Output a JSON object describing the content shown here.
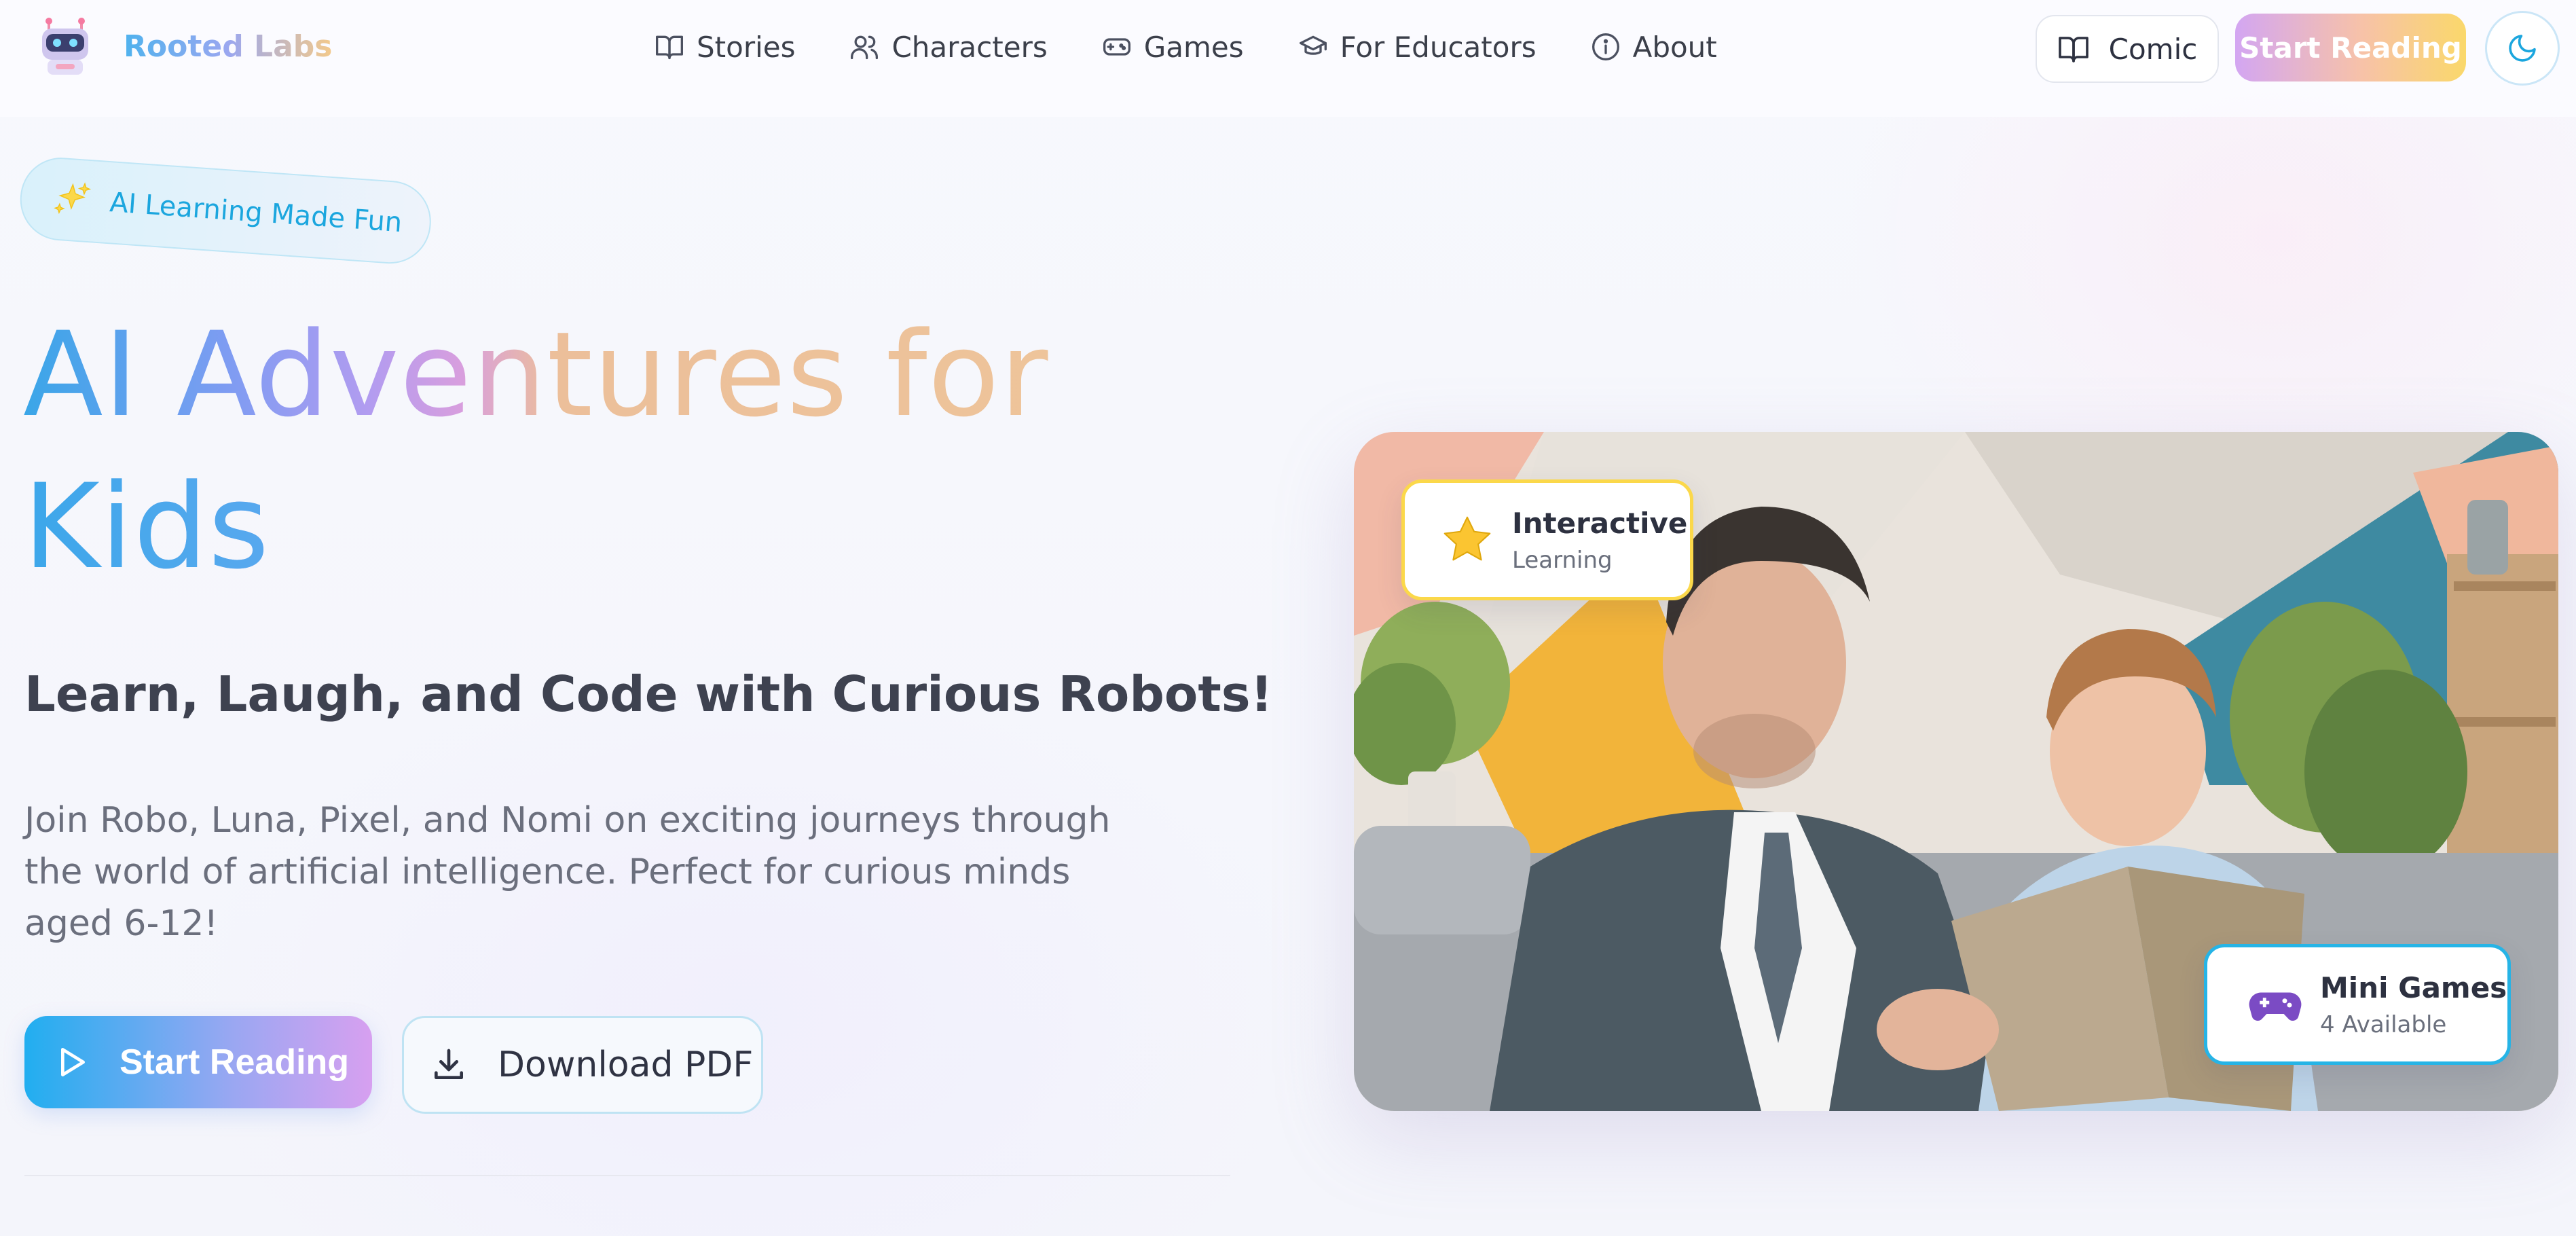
{
  "brand": {
    "name": "Rooted Labs"
  },
  "nav": [
    {
      "label": "Stories",
      "icon": "book-icon"
    },
    {
      "label": "Characters",
      "icon": "users-icon"
    },
    {
      "label": "Games",
      "icon": "gamepad-icon"
    },
    {
      "label": "For Educators",
      "icon": "graduation-cap-icon"
    },
    {
      "label": "About",
      "icon": "info-icon"
    }
  ],
  "header_actions": {
    "comic_label": "Comic",
    "start_reading_label": "Start Reading",
    "theme_toggle_icon": "moon-icon"
  },
  "badge": {
    "label": "AI Learning Made Fun",
    "icon": "sparkles-icon"
  },
  "hero": {
    "title_line1": "AI Adventures for",
    "title_line2": "Kids",
    "subtitle": "Learn, Laugh, and Code with Curious Robots!",
    "description": "Join Robo, Luna, Pixel, and Nomi on exciting journeys through the world of artificial intelligence. Perfect for curious minds aged 6-12!",
    "primary_button": "Start Reading",
    "secondary_button": "Download PDF"
  },
  "feature_cards": {
    "interactive": {
      "title": "Interactive",
      "subtitle": "Learning",
      "icon": "star-icon"
    },
    "games": {
      "title": "Mini Games",
      "subtitle": "4 Available",
      "icon": "gamepad-icon"
    }
  },
  "colors": {
    "accent_blue": "#21aef0",
    "accent_purple": "#d7a0f0",
    "accent_yellow": "#fad86b",
    "text_dark": "#2d3140",
    "text_muted": "#6b6f7d"
  }
}
